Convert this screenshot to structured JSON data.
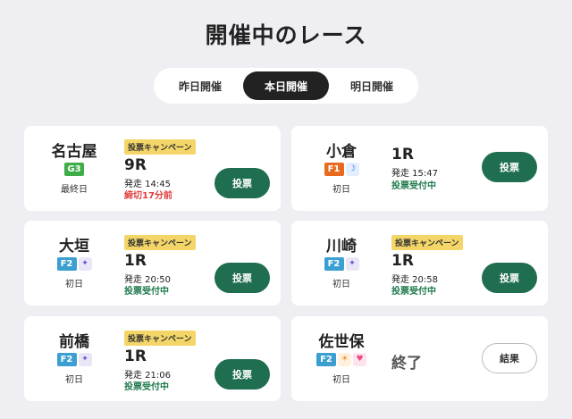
{
  "page": {
    "title": "開催中のレース"
  },
  "tabs": [
    {
      "label": "昨日開催",
      "active": false
    },
    {
      "label": "本日開催",
      "active": true
    },
    {
      "label": "明日開催",
      "active": false
    }
  ],
  "races": [
    {
      "venue": "名古屋",
      "grade": "G3",
      "icons": [],
      "day": "最終日",
      "campaign": "投票キャンペーン",
      "race": "9R",
      "start": "発走 14:45",
      "status": "締切17分前",
      "status_type": "closing",
      "button": "投票"
    },
    {
      "venue": "小倉",
      "grade": "F1",
      "icons": [
        "moon-icon"
      ],
      "day": "初日",
      "campaign": "",
      "race": "1R",
      "start": "発走 15:47",
      "status": "投票受付中",
      "status_type": "open",
      "button": "投票"
    },
    {
      "venue": "大垣",
      "grade": "F2",
      "icons": [
        "night-icon"
      ],
      "day": "初日",
      "campaign": "投票キャンペーン",
      "race": "1R",
      "start": "発走 20:50",
      "status": "投票受付中",
      "status_type": "open",
      "button": "投票"
    },
    {
      "venue": "川崎",
      "grade": "F2",
      "icons": [
        "night-icon"
      ],
      "day": "初日",
      "campaign": "投票キャンペーン",
      "race": "1R",
      "start": "発走 20:58",
      "status": "投票受付中",
      "status_type": "open",
      "button": "投票"
    },
    {
      "venue": "前橋",
      "grade": "F2",
      "icons": [
        "night-icon"
      ],
      "day": "初日",
      "campaign": "投票キャンペーン",
      "race": "1R",
      "start": "発走 21:06",
      "status": "投票受付中",
      "status_type": "open",
      "button": "投票"
    },
    {
      "venue": "佐世保",
      "grade": "F2",
      "icons": [
        "sun-icon",
        "heart-icon"
      ],
      "day": "初日",
      "campaign": "",
      "race": "",
      "start": "",
      "ended": "終了",
      "status": "",
      "status_type": "",
      "button": "結果"
    }
  ],
  "colors": {
    "vote_button": "#1f6e4f",
    "campaign_badge": "#f4d668",
    "status_open": "#1f7a4c",
    "status_closing": "#e23b3b"
  }
}
